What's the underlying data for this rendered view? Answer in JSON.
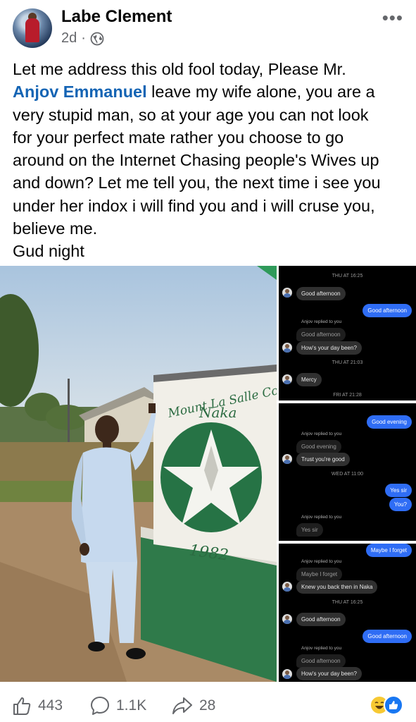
{
  "post": {
    "author": "Labe Clement",
    "time": "2d",
    "separator": "·",
    "privacy_icon": "globe-icon",
    "more_icon": "more-dots-icon",
    "text_line1": "Let me address this old fool today, Please Mr.",
    "mention": "Anjov Emmanuel",
    "text_after_mention": " leave my wife alone, you are a",
    "text_lines": [
      "very stupid man, so at your age you can not look",
      "for your perfect mate rather you choose to go",
      "around on the Internet Chasing people's Wives up",
      "and down? Let me tell you, the next time i see you",
      "under her indox i will find you and i will cruse you,",
      "believe me.",
      "Gud  night"
    ]
  },
  "photo": {
    "sign_line1": "Mount La Salle College",
    "sign_line2": "Naka",
    "sign_year": "1982"
  },
  "chat1": {
    "ts1": "THU AT 16:25",
    "msg1": "Good afternoon",
    "out1": "Good afternoon",
    "reply_note": "Anjov replied to you",
    "quoted": "Good afternoon",
    "msg2": "How's your day been?",
    "ts2": "THU AT 21:03",
    "msg3": "Mercy",
    "ts3": "FRI AT 21:28"
  },
  "chat2": {
    "out1": "Good evening",
    "reply_note1": "Anjov replied to you",
    "quoted1": "Good evening",
    "msg1": "Trust you're good",
    "ts1": "WED AT 11:00",
    "out2": "Yes sir",
    "out3": "You?",
    "reply_note2": "Anjov replied to you",
    "quoted2": "Yes sir"
  },
  "chat3": {
    "out1": "Maybe I forget",
    "reply_note1": "Anjov replied to you",
    "quoted1": "Maybe I forget",
    "msg1": "Knew you back then in Naka",
    "ts1": "THU AT 16:25",
    "msg2": "Good afternoon",
    "out2": "Good afternoon",
    "reply_note2": "Anjov replied to you",
    "quoted2": "Good afternoon",
    "msg3": "How's your day been?"
  },
  "footer": {
    "likes": "443",
    "comments": "1.1K",
    "shares": "28",
    "like_icon": "thumbs-up-icon",
    "comment_icon": "comment-bubble-icon",
    "share_icon": "share-arrow-icon"
  }
}
